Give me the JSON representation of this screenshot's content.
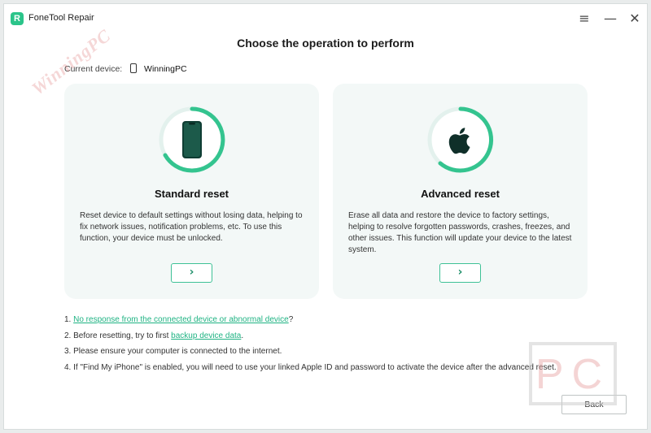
{
  "app": {
    "title": "FoneTool Repair",
    "logo_letter": "R",
    "menu_icon": "≡",
    "minimize_icon": "—",
    "close_icon": "✕"
  },
  "page_title": "Choose the operation to perform",
  "current_device": {
    "label": "Current device:",
    "name": "WinningPC"
  },
  "cards": [
    {
      "title": "Standard reset",
      "icon": "phone-icon",
      "description": "Reset device to default settings without losing data, helping to fix network issues, notification problems, etc. To use this function, your device must be unlocked.",
      "button": "›"
    },
    {
      "title": "Advanced reset",
      "icon": "apple-logo-icon",
      "description": "Erase all data and restore the device to factory settings, helping to resolve forgotten passwords, crashes, freezes, and other issues. This function will update your device to the latest system.",
      "button": "›"
    }
  ],
  "notes": [
    {
      "prefix": "1. ",
      "link": "No response from the connected device or abnormal device",
      "suffix": "?"
    },
    {
      "prefix": "2. Before resetting, try to first ",
      "link": "backup device data",
      "suffix": "."
    },
    {
      "prefix": "3. Please ensure your computer is connected to the internet.",
      "link": "",
      "suffix": ""
    },
    {
      "prefix": "4. If \"Find My iPhone\" is enabled, you will need to use your linked Apple ID and password to activate the device after the advanced reset.",
      "link": "",
      "suffix": ""
    }
  ],
  "back_button": "Back",
  "watermark": {
    "text": "WinningPC",
    "box_text": "PC"
  },
  "colors": {
    "accent": "#2bc48a",
    "link": "#1fb383",
    "card_bg": "#f3f8f7"
  }
}
